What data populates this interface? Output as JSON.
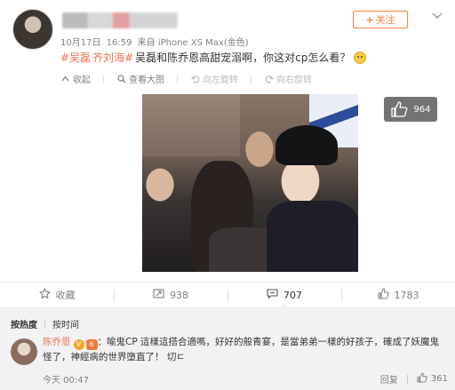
{
  "post": {
    "meta_date": "10月17日",
    "meta_time": "16:59",
    "meta_source": "来自 iPhone XS Max(金色)",
    "topics": [
      "#吴磊",
      "齐刘海#"
    ],
    "text": "吴磊和陈乔恩高甜宠溺啊，你这对cp怎么看？",
    "emoji": "smile-emoji"
  },
  "header": {
    "follow_plus": "+",
    "follow_label": "关注",
    "more_icon": "chevron-down-icon"
  },
  "media_toolbar": {
    "collapse": "收起",
    "view_large": "查看大图",
    "rotate_left": "向左旋转",
    "rotate_right": "向右旋转"
  },
  "media": {
    "like_count": "964"
  },
  "actions": {
    "favorite": "收藏",
    "repost": "938",
    "comment": "707",
    "like": "1783"
  },
  "comments_section": {
    "sort_hot": "按热度",
    "sort_time": "按时间"
  },
  "comment": {
    "author": "陈乔恩",
    "badge_v": "V",
    "badge_rank": "6",
    "text": "：喻鬼CP 這樣這搭合適嗎，好好的般青宴，是當弟弟一樣的好孩子，確成了妖魔鬼怪了，神經病的世界墮直了！ 切ㄷ",
    "time": "今天 00:47",
    "reply": "回复",
    "likes": "361"
  },
  "colors": {
    "accent": "#ff8140",
    "topic": "#eb7350",
    "muted": "#808080",
    "comment_bg": "#f2f2f5"
  }
}
